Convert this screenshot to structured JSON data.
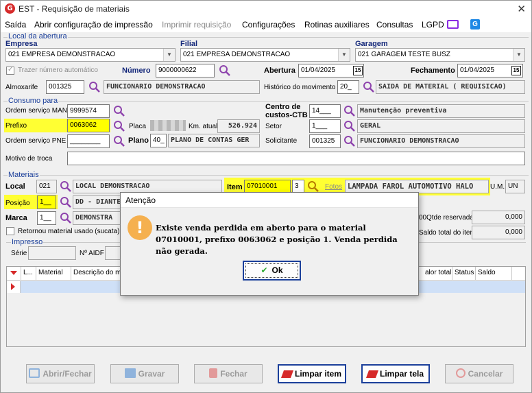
{
  "window": {
    "title": "EST - Requisição de materiais",
    "icon_letter": "G",
    "close_glyph": "✕"
  },
  "menu": {
    "items": [
      "Saída",
      "Abrir configuração de impressão",
      "Imprimir requisição",
      "Configurações",
      "Rotinas auxiliares",
      "Consultas",
      "LGPD"
    ]
  },
  "local_abertura": {
    "group_title": "Local da abertura",
    "empresa_label": "Empresa",
    "empresa_value": "021 EMPRESA DEMONSTRACAO",
    "filial_label": "Filial",
    "filial_value": "021 EMPRESA DEMONSTRACAO",
    "garagem_label": "Garagem",
    "garagem_value": "021 GARAGEM TESTE BUSZ",
    "trazer_numero_label": "Trazer número automático",
    "numero_label": "Número",
    "numero_value": "9000000622",
    "abertura_label": "Abertura",
    "abertura_value": "01/04/2025",
    "fechamento_label": "Fechamento",
    "fechamento_value": "01/04/2025",
    "calendar_glyph": "15",
    "almoxarife_label": "Almoxarife",
    "almoxarife_code": "001325",
    "almoxarife_name": "FUNCIONARIO DEMONSTRACAO",
    "historico_label": "Histórico do movimento",
    "historico_code": "20_",
    "historico_desc": "SAIDA DE MATERIAL ( REQUISICAO)"
  },
  "consumo": {
    "group_title": "Consumo para",
    "os_man_label": "Ordem serviço MAN",
    "os_man_value": "9999574",
    "prefixo_label": "Prefixo",
    "prefixo_value": "0063062",
    "placa_label": "Placa",
    "km_label": "Km. atual",
    "km_value": "526.924",
    "os_pne_label": "Ordem serviço PNE",
    "os_pne_value": "________",
    "plano_label": "Plano",
    "plano_code": "40_",
    "plano_desc": "PLANO DE CONTAS GER",
    "centro_label_1": "Centro de",
    "centro_label_2": "custos-CTB",
    "centro_code": "14___",
    "centro_desc": "Manutenção preventiva",
    "setor_label": "Setor",
    "setor_code": "1___",
    "setor_desc": "GERAL",
    "solicitante_label": "Solicitante",
    "solicitante_code": "001325",
    "solicitante_desc": "FUNCIONARIO DEMONSTRACAO",
    "motivo_label": "Motivo de troca",
    "motivo_value": ""
  },
  "materiais": {
    "group_title": "Materiais",
    "local_label": "Local",
    "local_code": "021",
    "local_desc": "LOCAL DEMONSTRACAO",
    "item_label": "Item",
    "item_code": "07010001",
    "item_seq": "3",
    "fotos_label": "Fotos",
    "item_desc": "LAMPADA FAROL AUTOMOTIVO HALO",
    "um_label": "U.M.",
    "um_value": "UN",
    "posicao_label": "Posição",
    "posicao_value": "1__",
    "posicao_desc": "DD - DIANTE",
    "marca_label": "Marca",
    "marca_value": "1__",
    "marca_desc": "DEMONSTRA",
    "qtde_label": "Qtde reservada",
    "qtde_value": "0,000",
    "saldo_label": "Saldo total do item",
    "saldo_value": "0,000",
    "qtd_partial": "00",
    "retornou_label": "Retornou material usado (sucata)",
    "impresso_title": "Impresso",
    "serie_label": "Série",
    "aidf_label": "Nº AIDF"
  },
  "grid": {
    "columns": [
      "L...",
      "Material",
      "Descrição do ma",
      "alor total",
      "Status",
      "Saldo"
    ]
  },
  "buttons": {
    "abrir_fechar": "Abrir/Fechar",
    "gravar": "Gravar",
    "fechar": "Fechar",
    "limpar_item": "Limpar item",
    "limpar_tela": "Limpar tela",
    "cancelar": "Cancelar"
  },
  "dialog": {
    "title": "Atenção",
    "icon_glyph": "!",
    "message": "Existe venda perdida em aberto para o material 07010001, prefixo 0063062 e posição 1. Venda perdida não gerada.",
    "ok_label": "Ok"
  },
  "colors": {
    "highlight": "#ffff33",
    "accent_blue": "#1b3f9a",
    "warning_orange": "#f5b04f",
    "search_icon": "#8e44ad"
  }
}
